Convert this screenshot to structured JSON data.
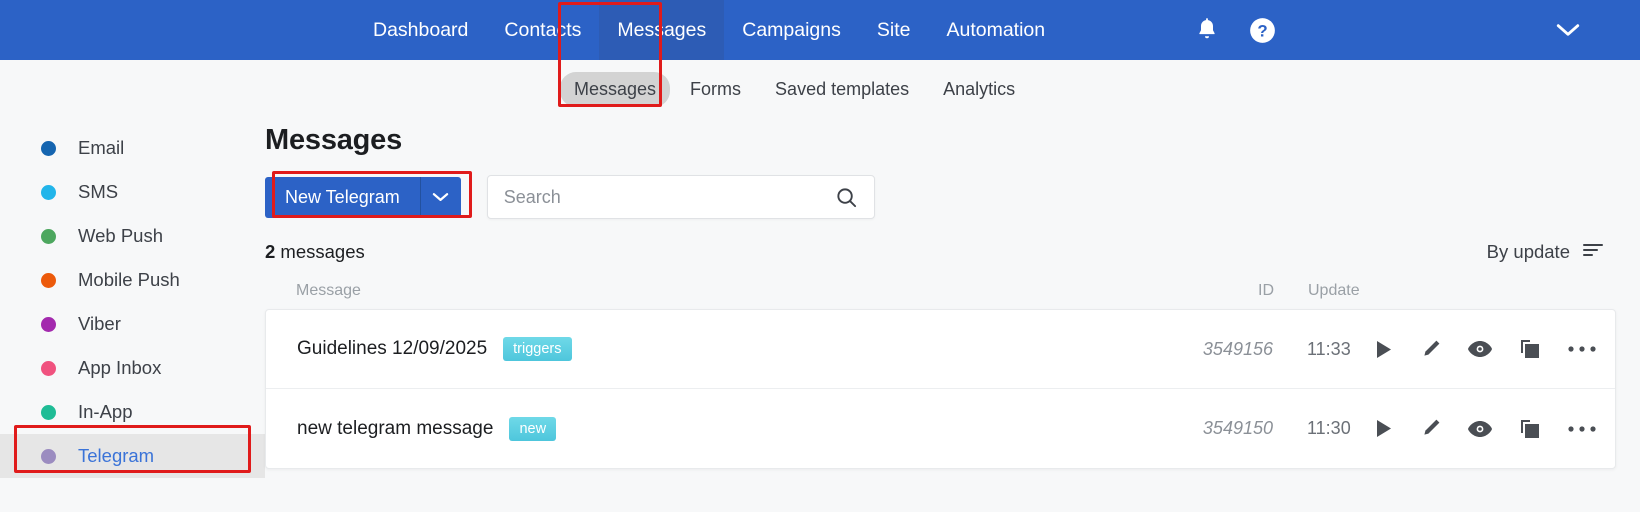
{
  "topnav": {
    "links": [
      {
        "label": "Dashboard",
        "active": false
      },
      {
        "label": "Contacts",
        "active": false
      },
      {
        "label": "Messages",
        "active": true
      },
      {
        "label": "Campaigns",
        "active": false
      },
      {
        "label": "Site",
        "active": false
      },
      {
        "label": "Automation",
        "active": false
      }
    ],
    "icons": [
      "bell-icon",
      "help-icon",
      "chevron-down-icon"
    ],
    "background": "#2c62c6",
    "active_background": "#2d5cb5"
  },
  "subnav": {
    "items": [
      {
        "label": "Messages",
        "active": true
      },
      {
        "label": "Forms",
        "active": false
      },
      {
        "label": "Saved templates",
        "active": false
      },
      {
        "label": "Analytics",
        "active": false
      }
    ]
  },
  "sidebar": {
    "items": [
      {
        "label": "Email",
        "color": "#1565b0",
        "active": false
      },
      {
        "label": "SMS",
        "color": "#22b5ea",
        "active": false
      },
      {
        "label": "Web Push",
        "color": "#4da75f",
        "active": false
      },
      {
        "label": "Mobile Push",
        "color": "#ec5a0b",
        "active": false
      },
      {
        "label": "Viber",
        "color": "#a32aae",
        "active": false
      },
      {
        "label": "App Inbox",
        "color": "#f0527f",
        "active": false
      },
      {
        "label": "In-App",
        "color": "#1fbc96",
        "active": false
      },
      {
        "label": "Telegram",
        "color": "#9b8cc0",
        "active": true
      }
    ]
  },
  "main": {
    "title": "Messages",
    "new_button": {
      "label": "New Telegram",
      "caret": "chevron-down-icon"
    },
    "search": {
      "value": "",
      "placeholder": "Search",
      "icon": "search-icon"
    },
    "count_number": "2",
    "count_suffix": " messages",
    "sort": {
      "label": "By update",
      "icon": "sort-icon"
    },
    "table": {
      "columns": {
        "message": "Message",
        "id": "ID",
        "update": "Update"
      },
      "rows": [
        {
          "name": "Guidelines 12/09/2025",
          "badge": "triggers",
          "id": "3549156",
          "update": "11:33",
          "actions": [
            "play-icon",
            "pencil-icon",
            "eye-icon",
            "copy-icon",
            "more-icon"
          ]
        },
        {
          "name": "new telegram message",
          "badge": "new",
          "id": "3549150",
          "update": "11:30",
          "actions": [
            "play-icon",
            "pencil-icon",
            "eye-icon",
            "copy-icon",
            "more-icon"
          ]
        }
      ]
    }
  },
  "highlights": {
    "color": "#e01b1b",
    "targets": [
      "messages-nav-and-subtab",
      "new-telegram-button",
      "sidebar-telegram"
    ]
  }
}
